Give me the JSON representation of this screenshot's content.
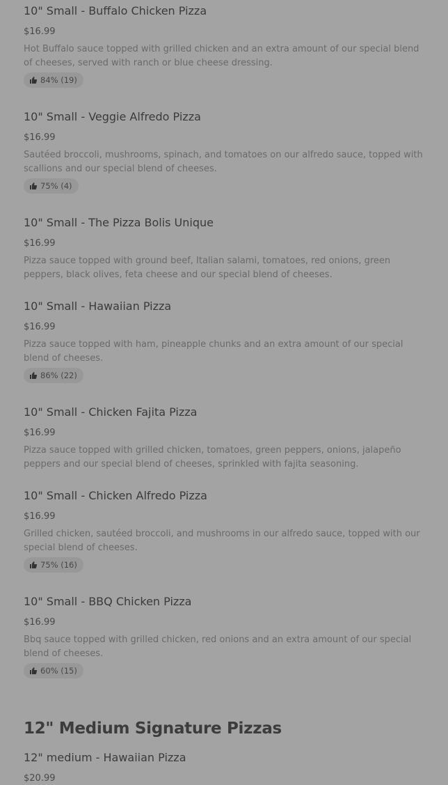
{
  "items": [
    {
      "name": "10\" Small - Buffalo Chicken Pizza",
      "price": "$16.99",
      "description": "Hot Buffalo sauce topped with grilled chicken and an extra amount of our special blend of cheeses, served with ranch or blue cheese dressing.",
      "rating": "84% (19)"
    },
    {
      "name": "10\" Small - Veggie Alfredo Pizza",
      "price": "$16.99",
      "description": "Sautéed broccoli, mushrooms, spinach, and tomatoes on our alfredo sauce, topped with scallions and our special blend of cheeses.",
      "rating": "75% (4)"
    },
    {
      "name": "10\" Small - The Pizza Bolis Unique",
      "price": "$16.99",
      "description": "Pizza sauce topped with ground beef, Italian salami, tomatoes, red onions, green peppers, black olives, feta cheese and our special blend of cheeses."
    },
    {
      "name": "10\" Small - Hawaiian Pizza",
      "price": "$16.99",
      "description": "Pizza sauce topped with ham, pineapple chunks and an extra amount of our special blend of cheeses.",
      "rating": "86% (22)"
    },
    {
      "name": "10\" Small - Chicken Fajita Pizza",
      "price": "$16.99",
      "description": "Pizza sauce topped with grilled chicken, tomatoes, green peppers, onions, jalapeño peppers and our special blend of cheeses, sprinkled with fajita seasoning."
    },
    {
      "name": "10\" Small - Chicken Alfredo Pizza",
      "price": "$16.99",
      "description": "Grilled chicken, sautéed broccoli, and mushrooms in our alfredo sauce, topped with our special blend of cheeses.",
      "rating": "75% (16)"
    },
    {
      "name": "10\" Small - BBQ Chicken Pizza",
      "price": "$16.99",
      "description": "Bbq sauce topped with grilled chicken, red onions and an extra amount of our special blend of cheeses.",
      "rating": "60% (15)"
    }
  ],
  "section": {
    "title": "12\" Medium Signature Pizzas",
    "items": [
      {
        "name": "12\" medium - Hawaiian Pizza",
        "price": "$20.99"
      }
    ]
  },
  "icons": {
    "rating": "thumbs-up-icon"
  },
  "colors": {
    "background": "#a3a3a3",
    "rating_chip": "#989898",
    "title_text": "#3b3b3b",
    "description_text": "#6a6a6a"
  }
}
